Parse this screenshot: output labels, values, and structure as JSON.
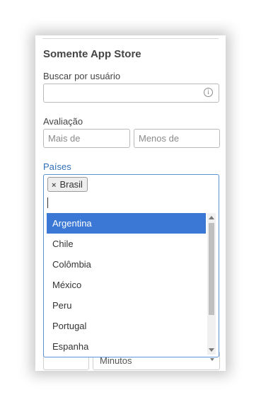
{
  "filter_panel": {
    "title": "Somente App Store",
    "user_search": {
      "label": "Buscar por usuário",
      "value": "",
      "info_icon": "info-circle-icon"
    },
    "rating": {
      "label": "Avaliação",
      "min_placeholder": "Mais de",
      "max_placeholder": "Menos de"
    },
    "countries": {
      "label": "Países",
      "label_color": "#2f6fb7",
      "selected_tags": [
        {
          "label": "Brasil",
          "remove_glyph": "×"
        }
      ],
      "search_value": "",
      "options": [
        {
          "label": "Argentina",
          "highlighted": true
        },
        {
          "label": "Chile",
          "highlighted": false
        },
        {
          "label": "Colômbia",
          "highlighted": false
        },
        {
          "label": "México",
          "highlighted": false
        },
        {
          "label": "Peru",
          "highlighted": false
        },
        {
          "label": "Portugal",
          "highlighted": false
        },
        {
          "label": "Espanha",
          "highlighted": false
        }
      ],
      "highlight_color": "#3b78d6"
    },
    "duration": {
      "unit_value": "Minutos"
    }
  }
}
